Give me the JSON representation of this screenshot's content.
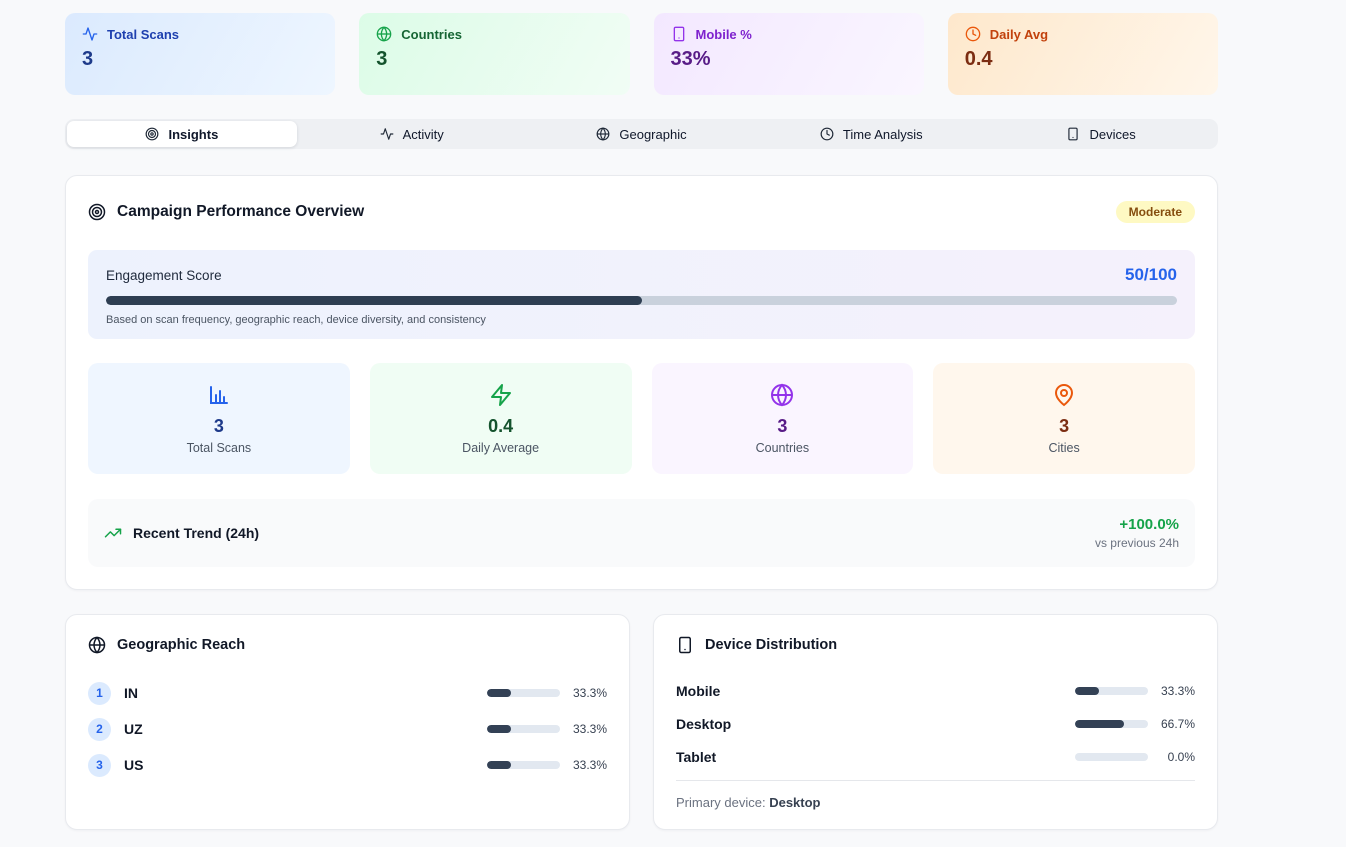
{
  "colors": {
    "accent_blue": "#2563eb",
    "accent_green": "#16a34a",
    "accent_purple": "#9333ea",
    "accent_orange": "#ea580c",
    "bar_fill": "#334155",
    "badge_bg": "#fef9c3",
    "badge_text": "#854d0e",
    "trend_positive": "#16a34a"
  },
  "stats": [
    {
      "label": "Total Scans",
      "value": "3",
      "icon": "activity-icon"
    },
    {
      "label": "Countries",
      "value": "3",
      "icon": "globe-icon"
    },
    {
      "label": "Mobile %",
      "value": "33%",
      "icon": "smartphone-icon"
    },
    {
      "label": "Daily Avg",
      "value": "0.4",
      "icon": "clock-icon"
    }
  ],
  "tabs": [
    {
      "label": "Insights",
      "icon": "target-icon",
      "active": true
    },
    {
      "label": "Activity",
      "icon": "activity-icon",
      "active": false
    },
    {
      "label": "Geographic",
      "icon": "globe-icon",
      "active": false
    },
    {
      "label": "Time Analysis",
      "icon": "clock-icon",
      "active": false
    },
    {
      "label": "Devices",
      "icon": "smartphone-icon",
      "active": false
    }
  ],
  "overview": {
    "title": "Campaign Performance Overview",
    "badge": "Moderate",
    "engagement": {
      "label": "Engagement Score",
      "score": "50/100",
      "percent": 50,
      "caption": "Based on scan frequency, geographic reach, device diversity, and consistency"
    },
    "mini_stats": [
      {
        "value": "3",
        "label": "Total Scans",
        "icon": "bar-chart-icon"
      },
      {
        "value": "0.4",
        "label": "Daily Average",
        "icon": "zap-icon"
      },
      {
        "value": "3",
        "label": "Countries",
        "icon": "globe-icon"
      },
      {
        "value": "3",
        "label": "Cities",
        "icon": "map-pin-icon"
      }
    ],
    "trend": {
      "label": "Recent Trend (24h)",
      "icon": "trending-up-icon",
      "value": "+100.0%",
      "sub": "vs previous 24h"
    }
  },
  "geographic": {
    "title": "Geographic Reach",
    "icon": "globe-icon",
    "rows": [
      {
        "rank": "1",
        "code": "IN",
        "percent": 33.3,
        "percent_label": "33.3%"
      },
      {
        "rank": "2",
        "code": "UZ",
        "percent": 33.3,
        "percent_label": "33.3%"
      },
      {
        "rank": "3",
        "code": "US",
        "percent": 33.3,
        "percent_label": "33.3%"
      }
    ]
  },
  "devices": {
    "title": "Device Distribution",
    "icon": "smartphone-icon",
    "rows": [
      {
        "label": "Mobile",
        "percent": 33.3,
        "percent_label": "33.3%"
      },
      {
        "label": "Desktop",
        "percent": 66.7,
        "percent_label": "66.7%"
      },
      {
        "label": "Tablet",
        "percent": 0,
        "percent_label": "0.0%"
      }
    ],
    "primary_label": "Primary device:",
    "primary_value": "Desktop"
  }
}
